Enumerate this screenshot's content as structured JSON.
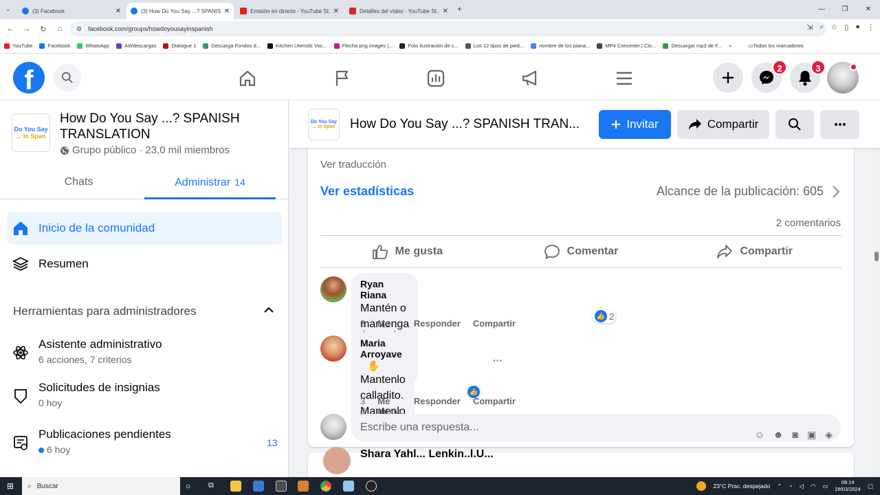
{
  "browser": {
    "tabs": [
      {
        "title": "(3) Facebook",
        "kind": "fb",
        "active": false
      },
      {
        "title": "(3) How Do You Say ...? SPANISH",
        "kind": "fb",
        "active": true
      },
      {
        "title": "Emisión en directo - YouTube St...",
        "kind": "yt",
        "active": false
      },
      {
        "title": "Detalles del vídeo - YouTube St...",
        "kind": "yt",
        "active": false
      }
    ],
    "url": "facebook.com/groups/howdoyousayinspanish",
    "bookmarks": [
      {
        "label": "YouTube",
        "color": "#e62117"
      },
      {
        "label": "Facebook",
        "color": "#1877f2"
      },
      {
        "label": "WhatsApp",
        "color": "#25d366"
      },
      {
        "label": "AWdescargas",
        "color": "#6a3db8"
      },
      {
        "label": "Dialogue 1",
        "color": "#b5121b"
      },
      {
        "label": "Descarga Fondos d...",
        "color": "#26a269"
      },
      {
        "label": "Kitchen Utensils Voc...",
        "color": "#111111"
      },
      {
        "label": "Flecha png images |...",
        "color": "#c2188c"
      },
      {
        "label": "Foto ilustración de c...",
        "color": "#222222"
      },
      {
        "label": "Los 12 tipos de pied...",
        "color": "#555555"
      },
      {
        "label": "nombre de los piana...",
        "color": "#4285f4"
      },
      {
        "label": "MP4 Converter | Clo...",
        "color": "#444444"
      },
      {
        "label": "Descargar mp3 de F...",
        "color": "#2e9e46"
      }
    ],
    "bookmarks_more": "»",
    "all_bookmarks": "Todos los marcadores"
  },
  "fbnav": {
    "logo": "f",
    "messenger_badge": "2",
    "notifications_badge": "3"
  },
  "group": {
    "thumb_line1": "Do You Say",
    "thumb_line2": "... in Span",
    "title": "How Do You Say ...? SPANISH TRANSLATION",
    "header_title": "How Do You Say ...? SPANISH TRAN...",
    "privacy": "Grupo público",
    "separator": "·",
    "members": "23,0 mil miembros"
  },
  "sidebar": {
    "tab_chats": "Chats",
    "tab_admin": "Administrar",
    "admin_count": "14",
    "home": "Inicio de la comunidad",
    "summary": "Resumen",
    "tools_header": "Herramientas para administradores",
    "tools": [
      {
        "title": "Asistente administrativo",
        "subtitle": "6 acciones, 7 criterios"
      },
      {
        "title": "Solicitudes de insignias",
        "subtitle": "0 hoy"
      },
      {
        "title": "Publicaciones pendientes",
        "subtitle": "6 hoy",
        "count": "13"
      }
    ]
  },
  "header_buttons": {
    "invite": "Invitar",
    "share": "Compartir"
  },
  "post": {
    "see_translation": "Ver traducción",
    "see_stats": "Ver estadísticas",
    "reach": "Alcance de la publicación: 605",
    "comment_count": "2 comentarios",
    "like": "Me gusta",
    "comment": "Comentar",
    "share": "Compartir"
  },
  "comments": [
    {
      "name": "Ryan Riana",
      "lines": [
        "Mantén o mantenga un tono bajo. No te pases."
      ],
      "age": "3 d",
      "like": "Me gusta",
      "reply": "Responder",
      "share": "Compartir",
      "reactions": "2"
    },
    {
      "name": "Maria Arroyave",
      "lines": [
        "Mantenlo calladito.",
        "Mantenlo calmado."
      ],
      "age": "3 d",
      "like": "Me gusta",
      "reply": "Responder",
      "share": "Compartir",
      "more": "···"
    }
  ],
  "reply_placeholder": "Escribe una respuesta...",
  "next_post_author": "Shara Yahl... Lenkin..l.U...",
  "taskbar": {
    "search": "Buscar",
    "weather": "23°C  Prac. despejado",
    "time": "08:14",
    "date": "28/03/2024"
  }
}
